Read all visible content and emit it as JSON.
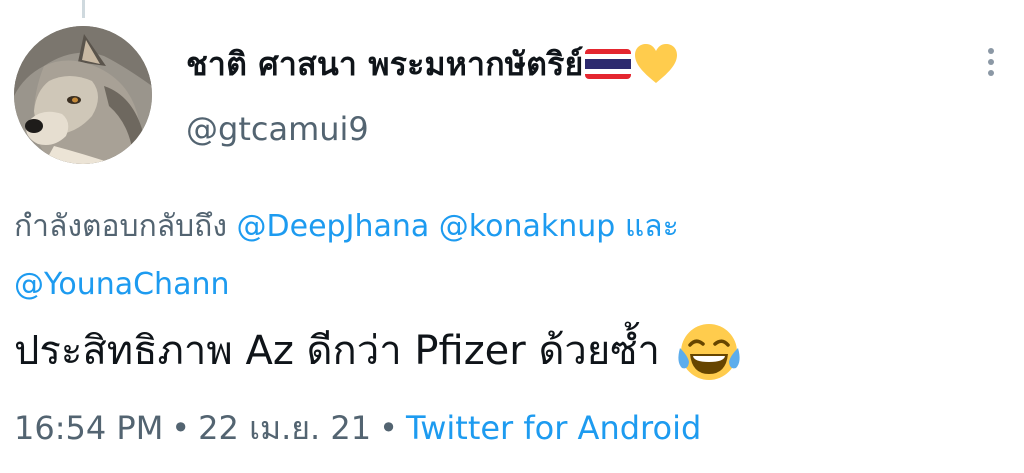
{
  "author": {
    "display_name": "ชาติ ศาสนา พระมหากษัตริย์",
    "handle": "@gtcamui9",
    "name_icons": [
      "thailand-flag-icon",
      "yellow-heart-icon"
    ]
  },
  "reply_context": {
    "prefix": "กำลังตอบกลับถึง",
    "mentions": [
      "@DeepJhana",
      "@konaknup",
      "@YounaChann"
    ],
    "conjunction": "และ"
  },
  "tweet": {
    "text": "ประสิทธิภาพ Az ดีกว่า Pfizer ด้วยซ้ำ",
    "emoji": "face-with-tears-of-joy-icon"
  },
  "meta": {
    "time": "16:54 PM",
    "separator": "•",
    "date": "22 เม.ย. 21",
    "source": "Twitter for Android"
  },
  "colors": {
    "link": "#1d9bf0",
    "secondary_text": "#536471",
    "primary_text": "#0f1419"
  }
}
